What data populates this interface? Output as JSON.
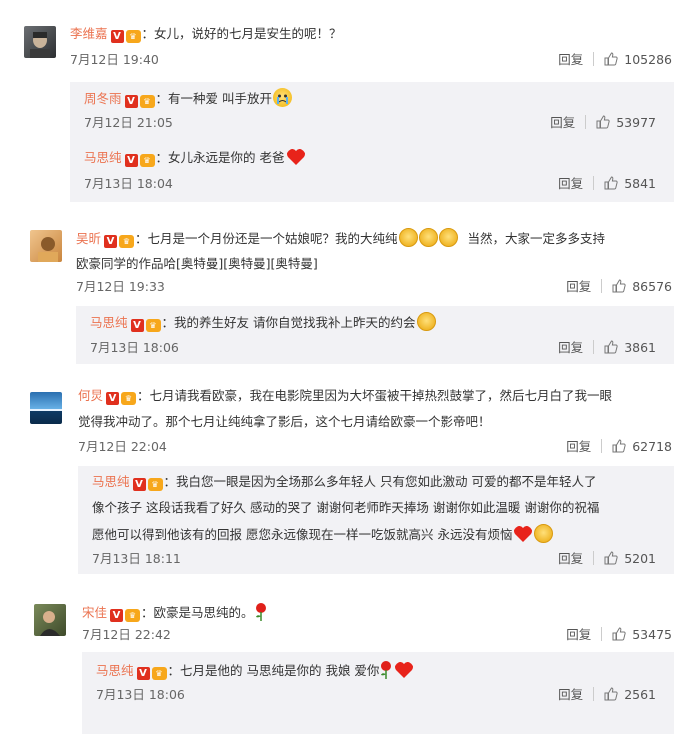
{
  "labels": {
    "reply": "回复"
  },
  "comments": [
    {
      "user": "李维嘉",
      "text": "：女儿，说好的七月是安生的呢！？",
      "time": "7月12日 19:40",
      "likes": "105286",
      "replies": [
        {
          "user": "周冬雨",
          "text": "：有一种爱 叫手放开",
          "time": "7月12日 21:05",
          "likes": "53977"
        },
        {
          "user": "马思纯",
          "text": "：女儿永远是你的 老爸",
          "time": "7月13日 18:04",
          "likes": "5841"
        }
      ]
    },
    {
      "user": "吴昕",
      "text_line1": "：七月是一个月份还是一个姑娘呢？我的大纯纯",
      "text_line1_tail": "当然，大家一定多多支持",
      "text_line2": "欧豪同学的作品哈[奥特曼][奥特曼][奥特曼]",
      "time": "7月12日 19:33",
      "likes": "86576",
      "replies": [
        {
          "user": "马思纯",
          "text": "：我的养生好友 请你自觉找我补上昨天的约会",
          "time": "7月13日 18:06",
          "likes": "3861"
        }
      ]
    },
    {
      "user": "何炅",
      "text_line1": "：七月请我看欧豪，我在电影院里因为大坏蛋被干掉热烈鼓掌了，然后七月白了我一眼",
      "text_line2": "觉得我冲动了。那个七月让纯纯拿了影后，这个七月请给欧豪一个影帝吧！",
      "time": "7月12日 22:04",
      "likes": "62718",
      "replies": [
        {
          "user": "马思纯",
          "text_line1": "：我白您一眼是因为全场那么多年轻人 只有您如此激动 可爱的都不是年轻人了",
          "text_line2": "像个孩子 这段话我看了好久 感动的哭了 谢谢何老师昨天捧场 谢谢你如此温暖 谢谢你的祝福",
          "text_line3": "愿他可以得到他该有的回报 愿您永远像现在一样一吃饭就高兴 永远没有烦恼",
          "time": "7月13日 18:11",
          "likes": "5201"
        }
      ]
    },
    {
      "user": "宋佳",
      "text": "：欧豪是马思纯的。",
      "time": "7月12日 22:42",
      "likes": "53475",
      "replies": [
        {
          "user": "马思纯",
          "text": "：七月是他的 马思纯是你的 我娘 爱你",
          "time": "7月13日 18:06",
          "likes": "2561"
        }
      ]
    }
  ],
  "icons": {
    "verified": "V",
    "crown": "crown-icon",
    "like": "thumbs-up-icon"
  },
  "colors": {
    "username": "#eb7350",
    "reply_bg": "#f2f2f5",
    "verified": "#e0301e",
    "crown": "#f7a71b"
  }
}
